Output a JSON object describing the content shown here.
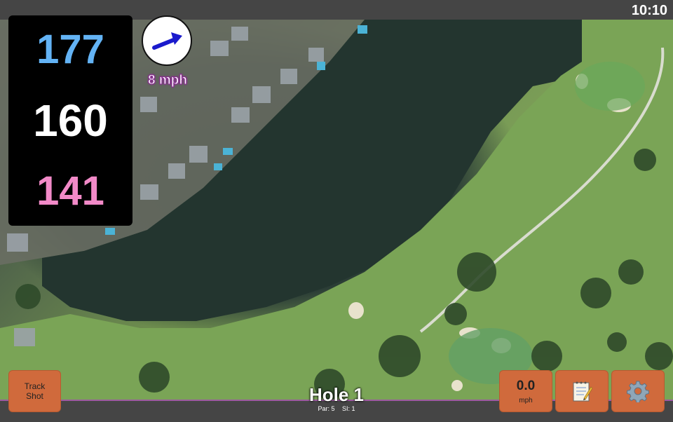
{
  "status_bar": {
    "time": "10:10"
  },
  "distances": {
    "back": "177",
    "middle": "160",
    "front": "141"
  },
  "wind": {
    "speed": "8 mph",
    "direction_icon": "arrow-east-icon"
  },
  "buttons": {
    "track_shot": "Track\nShot",
    "speed_value": "0.0",
    "speed_unit": "mph",
    "notes_icon": "notepad-icon",
    "settings_icon": "gear-icon"
  },
  "hole": {
    "title": "Hole 1",
    "par": "Par: 5",
    "si": "SI: 1"
  },
  "colors": {
    "back_distance": "#63b3f5",
    "middle_distance": "#ffffff",
    "front_distance": "#f28ac8",
    "button": "#d06a3c",
    "accent_border": "#9c5aa0"
  }
}
